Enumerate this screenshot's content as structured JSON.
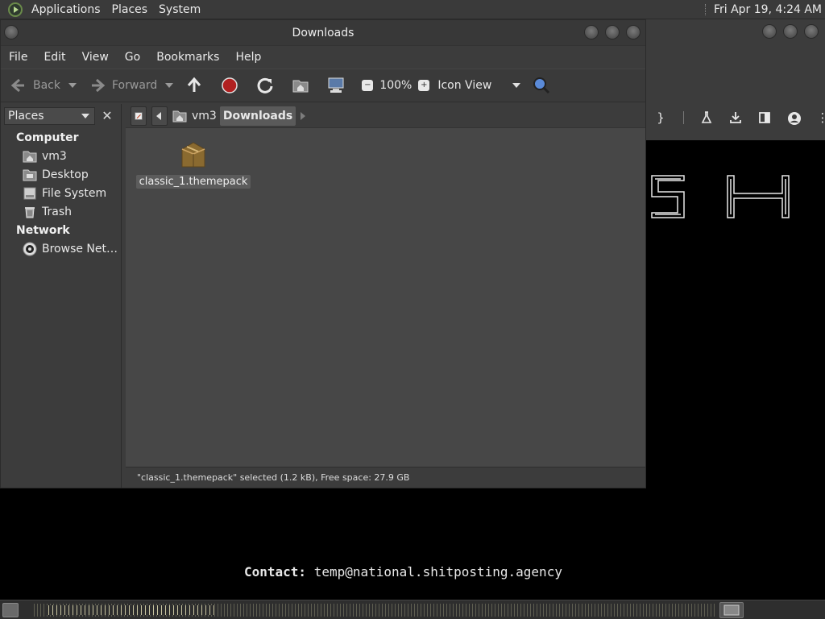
{
  "top_panel": {
    "menus": [
      "Applications",
      "Places",
      "System"
    ],
    "clock": "Fri Apr 19,  4:24 AM"
  },
  "file_manager": {
    "title": "Downloads",
    "menubar": [
      "File",
      "Edit",
      "View",
      "Go",
      "Bookmarks",
      "Help"
    ],
    "toolbar": {
      "back_label": "Back",
      "forward_label": "Forward",
      "zoom_level": "100%",
      "view_mode": "Icon View"
    },
    "sidebar": {
      "selector": "Places",
      "close": "✕",
      "sections": [
        {
          "title": "Computer",
          "items": [
            {
              "label": "vm3",
              "icon": "home-folder-icon"
            },
            {
              "label": "Desktop",
              "icon": "desktop-folder-icon"
            },
            {
              "label": "File System",
              "icon": "filesystem-icon"
            },
            {
              "label": "Trash",
              "icon": "trash-icon"
            }
          ]
        },
        {
          "title": "Network",
          "items": [
            {
              "label": "Browse Net…",
              "icon": "network-icon"
            }
          ]
        }
      ]
    },
    "pathbar": {
      "parent": "vm3",
      "current": "Downloads"
    },
    "files": [
      {
        "name": "classic_1.themepack",
        "icon": "package-icon",
        "selected": true
      }
    ],
    "status": "\"classic_1.themepack\" selected (1.2 kB), Free space: 27.9 GB"
  },
  "background": {
    "contact_label": "Contact:",
    "contact_value": "temp@national.shitposting.agency"
  },
  "colors": {
    "window_bg": "#3c3c3c",
    "content_bg": "#474747",
    "desktop_bg": "#000000",
    "stop_red": "#b02020"
  }
}
